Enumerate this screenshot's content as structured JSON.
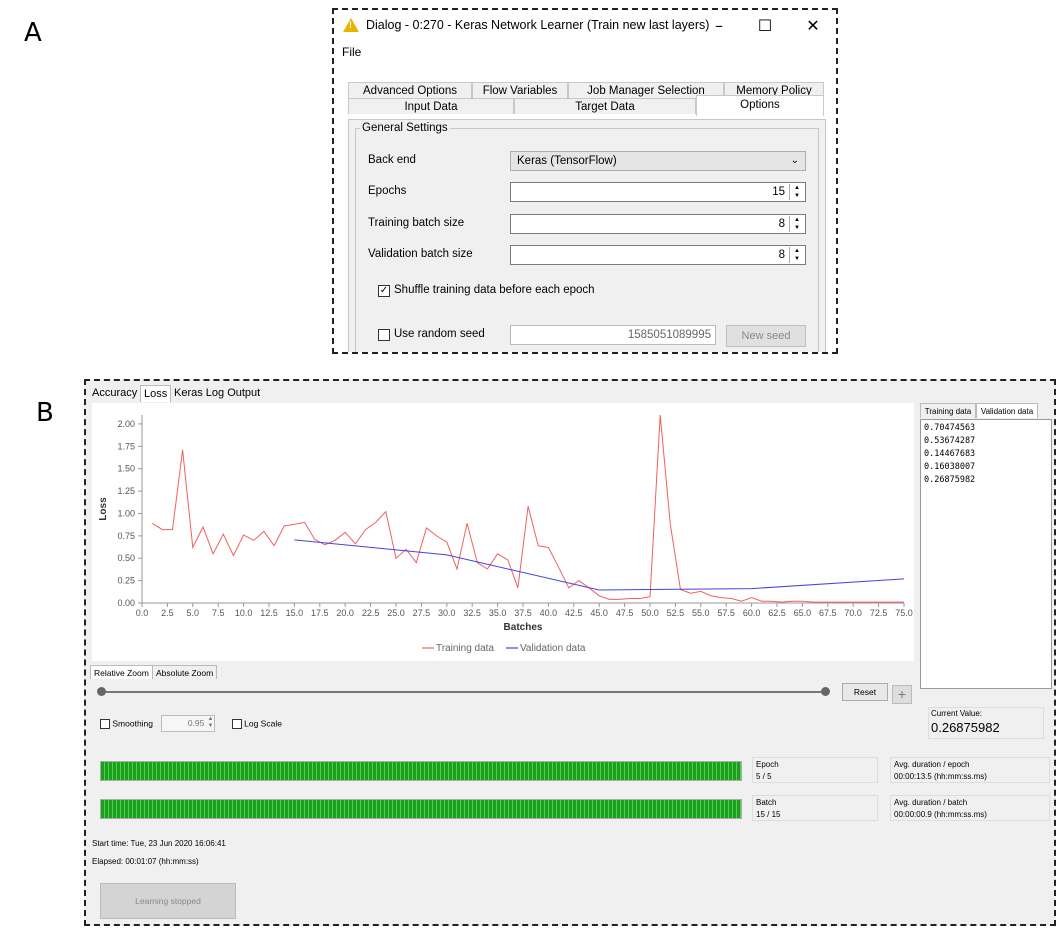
{
  "labels": {
    "a": "A",
    "b": "B"
  },
  "dialog": {
    "title": "Dialog - 0:270 - Keras Network Learner (Train new last layers)",
    "menu": {
      "file": "File"
    },
    "tabs_top": [
      "Advanced Options",
      "Flow Variables",
      "Job Manager Selection",
      "Memory Policy"
    ],
    "tabs_bottom": [
      "Input Data",
      "Target Data",
      "Options"
    ],
    "active_tab": "Options",
    "group_title": "General Settings",
    "back_end": {
      "label": "Back end",
      "value": "Keras (TensorFlow)"
    },
    "epochs": {
      "label": "Epochs",
      "value": "15"
    },
    "training_batch": {
      "label": "Training batch size",
      "value": "8"
    },
    "validation_batch": {
      "label": "Validation batch size",
      "value": "8"
    },
    "shuffle": {
      "label": "Shuffle training data before each epoch",
      "checked": true
    },
    "random_seed": {
      "label": "Use random seed",
      "checked": false,
      "value": "1585051089995"
    },
    "new_seed_label": "New seed",
    "accent_color": "#e9b400"
  },
  "monitor": {
    "tabs": [
      "Accuracy",
      "Loss",
      "Keras Log Output"
    ],
    "active_tab": "Loss",
    "side_tabs": [
      "Training data",
      "Validation data"
    ],
    "active_side_tab": "Validation data",
    "validation_values": [
      "0.70474563",
      "0.53674287",
      "0.14467683",
      "0.16038007",
      "0.26875982"
    ],
    "current_value_label": "Current Value:",
    "current_value": "0.26875982",
    "zoom_tabs": [
      "Relative Zoom",
      "Absolute Zoom"
    ],
    "reset_label": "Reset",
    "plus_label": "+",
    "smoothing_label": "Smoothing",
    "smoothing_value": "0.95",
    "log_scale_label": "Log Scale",
    "epoch_label": "Epoch",
    "epoch_value": "5 / 5",
    "epoch_progress": 1.0,
    "avg_epoch_label": "Avg. duration / epoch",
    "avg_epoch_value": "00:00:13.5 (hh:mm:ss.ms)",
    "batch_label": "Batch",
    "batch_value": "15 / 15",
    "batch_progress": 1.0,
    "avg_batch_label": "Avg. duration / batch",
    "avg_batch_value": "00:00:00.9 (hh:mm:ss.ms)",
    "start_time": "Start time: Tue, 23 Jun 2020 16:06:41",
    "elapsed": "Elapsed: 00:01:07 (hh:mm:ss)",
    "stop_label": "Learning stopped"
  },
  "chart_data": {
    "type": "line",
    "xlabel": "Batches",
    "ylabel": "Loss",
    "xlim": [
      0,
      75
    ],
    "ylim": [
      0,
      2.1
    ],
    "xticks": [
      "0.0",
      "2.5",
      "5.0",
      "7.5",
      "10.0",
      "12.5",
      "15.0",
      "17.5",
      "20.0",
      "22.5",
      "25.0",
      "27.5",
      "30.0",
      "32.5",
      "35.0",
      "37.5",
      "40.0",
      "42.5",
      "45.0",
      "47.5",
      "50.0",
      "52.5",
      "55.0",
      "57.5",
      "60.0",
      "62.5",
      "65.0",
      "67.5",
      "70.0",
      "72.5",
      "75.0"
    ],
    "yticks": [
      "0.00",
      "0.25",
      "0.50",
      "0.75",
      "1.00",
      "1.25",
      "1.50",
      "1.75",
      "2.00"
    ],
    "legend_position": "bottom",
    "series": [
      {
        "name": "Training data",
        "color": "#f06060",
        "x": [
          1,
          2,
          3,
          4,
          5,
          6,
          7,
          8,
          9,
          10,
          11,
          12,
          13,
          14,
          15,
          16,
          17,
          18,
          19,
          20,
          21,
          22,
          23,
          24,
          25,
          26,
          27,
          28,
          29,
          30,
          31,
          32,
          33,
          34,
          35,
          36,
          37,
          38,
          39,
          40,
          41,
          42,
          43,
          44,
          45,
          46,
          47,
          48,
          49,
          50,
          51,
          52,
          53,
          54,
          55,
          56,
          57,
          58,
          59,
          60,
          61,
          62,
          63,
          64,
          65,
          66,
          67,
          68,
          69,
          70,
          71,
          72,
          73,
          74,
          75
        ],
        "y": [
          0.89,
          0.82,
          0.82,
          1.71,
          0.62,
          0.85,
          0.55,
          0.77,
          0.53,
          0.76,
          0.7,
          0.8,
          0.64,
          0.86,
          0.88,
          0.9,
          0.71,
          0.65,
          0.7,
          0.79,
          0.66,
          0.82,
          0.9,
          1.02,
          0.5,
          0.6,
          0.45,
          0.84,
          0.75,
          0.68,
          0.38,
          0.89,
          0.45,
          0.38,
          0.55,
          0.48,
          0.17,
          1.08,
          0.64,
          0.62,
          0.4,
          0.17,
          0.25,
          0.17,
          0.08,
          0.04,
          0.04,
          0.05,
          0.05,
          0.07,
          2.1,
          0.88,
          0.15,
          0.11,
          0.13,
          0.08,
          0.06,
          0.05,
          0.02,
          0.06,
          0.02,
          0.02,
          0.01,
          0.02,
          0.02,
          0.01,
          0.01,
          0.01,
          0.01,
          0.01,
          0.01,
          0.01,
          0.01,
          0.01,
          0.01
        ]
      },
      {
        "name": "Validation data",
        "color": "#4444e0",
        "x": [
          15,
          30,
          45,
          60,
          75
        ],
        "y": [
          0.70474563,
          0.53674287,
          0.14467683,
          0.16038007,
          0.26875982
        ]
      }
    ]
  }
}
